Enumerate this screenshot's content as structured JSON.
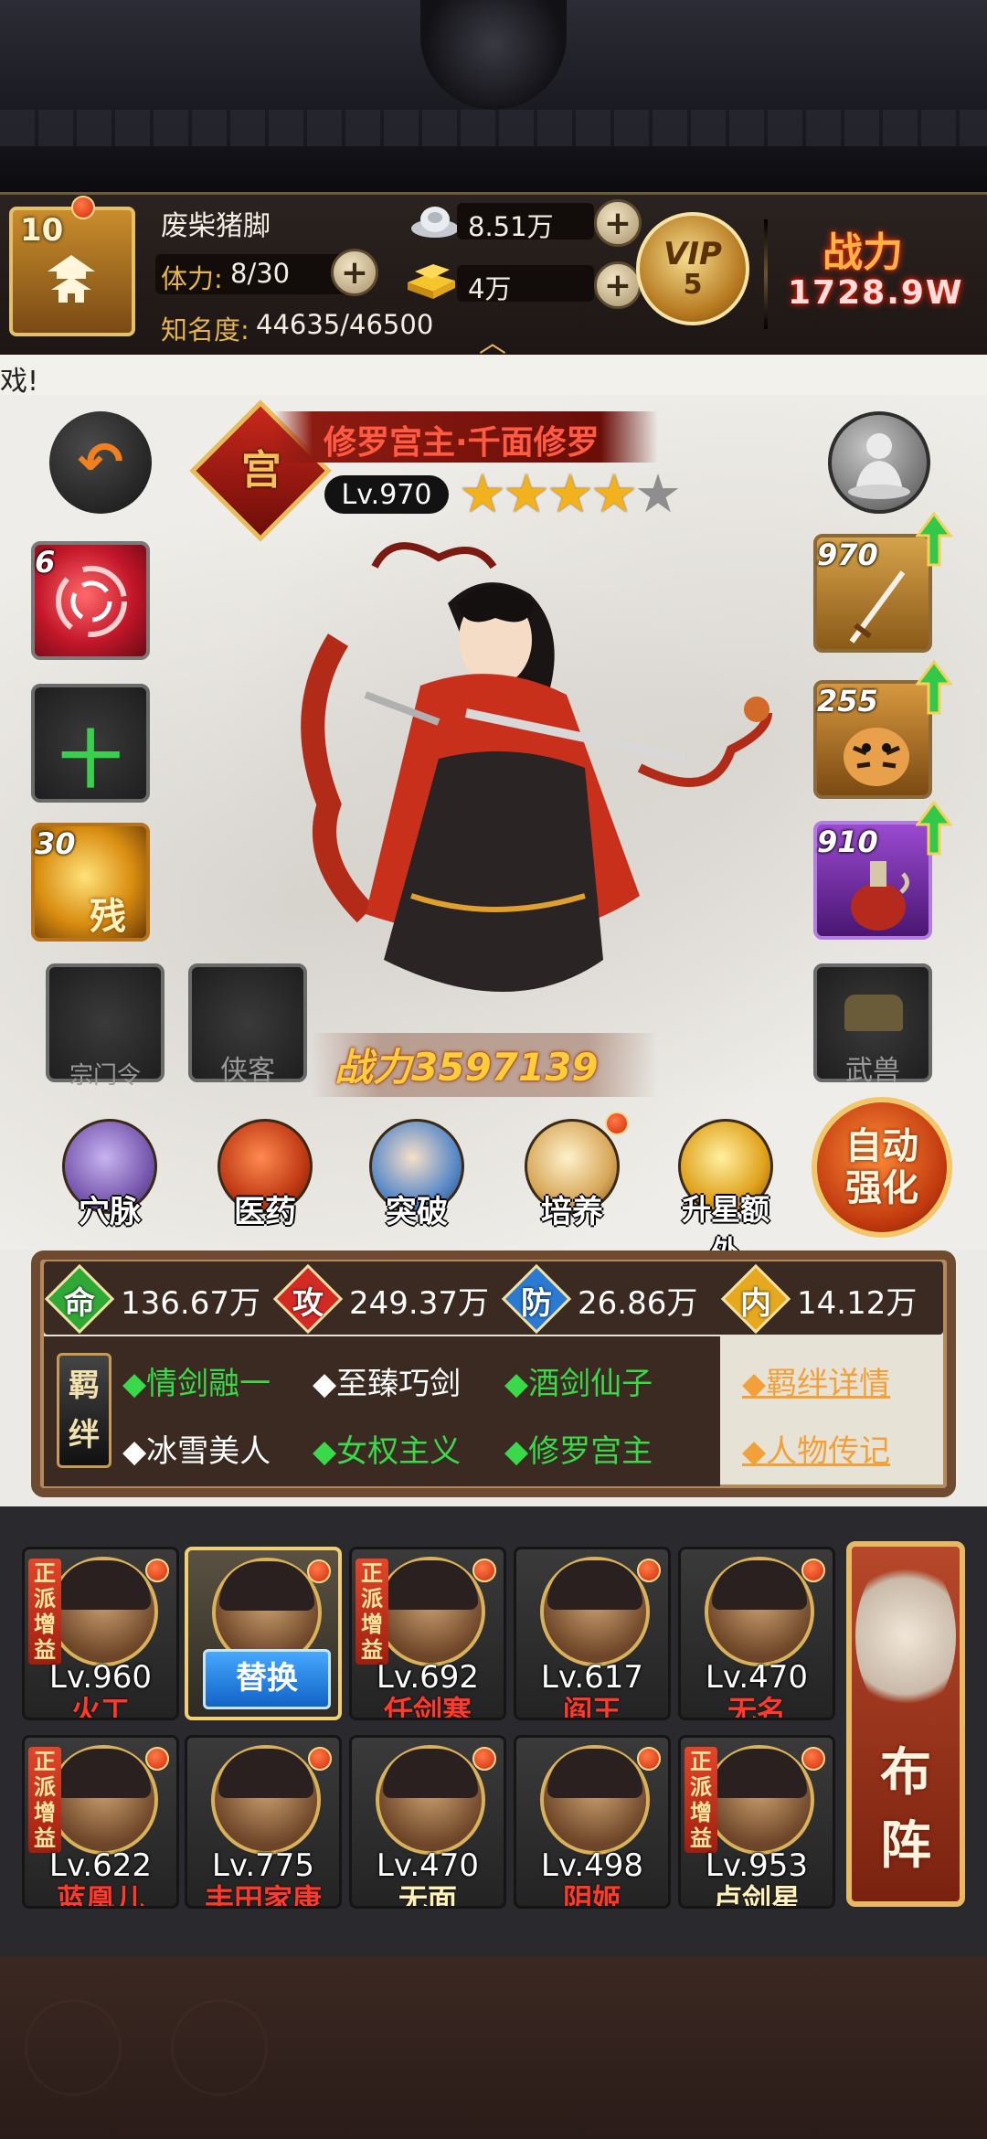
{
  "player": {
    "level": "10",
    "name": "废柴猪脚",
    "stamina_label": "体力:",
    "stamina_value": "8/30",
    "fame_label": "知名度:",
    "fame_value": "44635/46500",
    "silver": "8.51万",
    "gold": "4万",
    "vip_label": "VIP",
    "vip_level": "5",
    "power_label": "战力",
    "power_value": "1728.9W"
  },
  "marquee": "戏!",
  "hero": {
    "sect_char": "宫",
    "name": "修罗宫主·千面修罗",
    "level": "Lv.970",
    "stars_filled": 4,
    "stars_total": 5,
    "battle_power": "战力3597139",
    "left_slots": [
      {
        "num": "6",
        "color": "#d8283a"
      },
      {
        "num": "",
        "label": "十"
      },
      {
        "num": "30",
        "label": "残",
        "color": "#e8a51a"
      }
    ],
    "right_slots": [
      {
        "num": "970",
        "color": "#b77a22"
      },
      {
        "num": "255",
        "color": "#b77a22"
      },
      {
        "num": "910",
        "color": "#7a2aa5"
      }
    ],
    "empty_slots": [
      "宗门令",
      "侠客",
      "武兽"
    ]
  },
  "actions": [
    {
      "label": "穴脉",
      "icon": "meridian-icon"
    },
    {
      "label": "医药",
      "icon": "medicine-icon"
    },
    {
      "label": "突破",
      "icon": "breakthrough-icon"
    },
    {
      "label": "培养",
      "icon": "training-icon"
    },
    {
      "label": "升星额外",
      "icon": "star-up-icon"
    }
  ],
  "auto_enhance": "自动强化",
  "stats": [
    {
      "char": "命",
      "value": "136.67万",
      "color": "#2fa836"
    },
    {
      "char": "攻",
      "value": "249.37万",
      "color": "#d42a24"
    },
    {
      "char": "防",
      "value": "26.86万",
      "color": "#2a7ad4"
    },
    {
      "char": "内",
      "value": "14.12万",
      "color": "#e6a91d"
    }
  ],
  "bonds": {
    "seal": "羁绊",
    "row1": [
      {
        "text": "情剑融一",
        "active": true
      },
      {
        "text": "至臻巧剑",
        "active": false
      },
      {
        "text": "酒剑仙子",
        "active": true
      }
    ],
    "row2": [
      {
        "text": "冰雪美人",
        "active": false
      },
      {
        "text": "女权主义",
        "active": true
      },
      {
        "text": "修罗宫主",
        "active": true
      }
    ],
    "link_detail": "羁绊详情",
    "link_bio": "人物传记"
  },
  "roster": [
    {
      "level": "Lv.960",
      "name": "火工",
      "tag": "正派增益",
      "selected": false
    },
    {
      "level": "",
      "name": "",
      "swap": "替换",
      "selected": true
    },
    {
      "level": "Lv.692",
      "name": "任剑寒",
      "tag": "正派增益",
      "selected": false
    },
    {
      "level": "Lv.617",
      "name": "阎王",
      "tag": "",
      "selected": false
    },
    {
      "level": "Lv.470",
      "name": "无名",
      "tag": "",
      "selected": false
    },
    {
      "level": "Lv.622",
      "name": "蓝凰儿",
      "tag": "正派增益",
      "selected": false
    },
    {
      "level": "Lv.775",
      "name": "丰田家康",
      "tag": "",
      "selected": false
    },
    {
      "level": "Lv.470",
      "name": "无面",
      "tag": "",
      "selected": false,
      "yellow": true
    },
    {
      "level": "Lv.498",
      "name": "阴姬",
      "tag": "",
      "selected": false
    },
    {
      "level": "Lv.953",
      "name": "卢剑星",
      "tag": "正派增益",
      "selected": false,
      "yellow": true
    }
  ],
  "formation": "布阵"
}
